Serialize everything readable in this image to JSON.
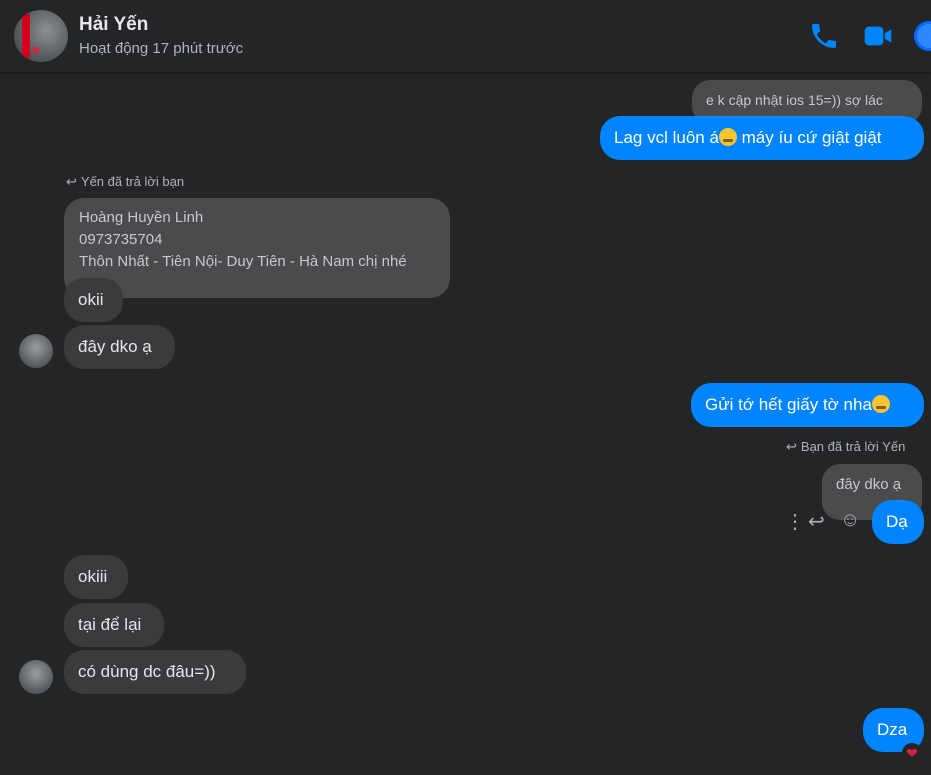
{
  "header": {
    "name": "Hải Yến",
    "status": "Hoạt động 17 phút trước",
    "colors": {
      "accent": "#0084ff",
      "background": "#242526"
    }
  },
  "messages": [
    {
      "quote": "e k cập nhật ios 15=)) sợ lác"
    },
    {
      "text": "Lag vcl luôn á",
      "text_after_emoji": " máy íu cứ giật giật"
    },
    {
      "reply_note": "Yến đã trả lời bạn"
    },
    {
      "quote_lines": [
        "Hoàng Huyền Linh",
        "0973735704",
        "Thôn Nhất - Tiên Nội- Duy Tiên - Hà Nam chị nhé"
      ]
    },
    {
      "text": "okii"
    },
    {
      "text": "đây dko ạ"
    },
    {
      "text": "Gửi tớ hết giấy tờ nha"
    },
    {
      "reply_note": "Bạn đã trả lời Yến"
    },
    {
      "quote": "đây dko ạ"
    },
    {
      "text": "Dạ"
    },
    {
      "text": "okiii"
    },
    {
      "text": "tại để lại"
    },
    {
      "text": "có dùng dc đâu=))"
    },
    {
      "text": "Dza",
      "reaction": "heart"
    }
  ]
}
